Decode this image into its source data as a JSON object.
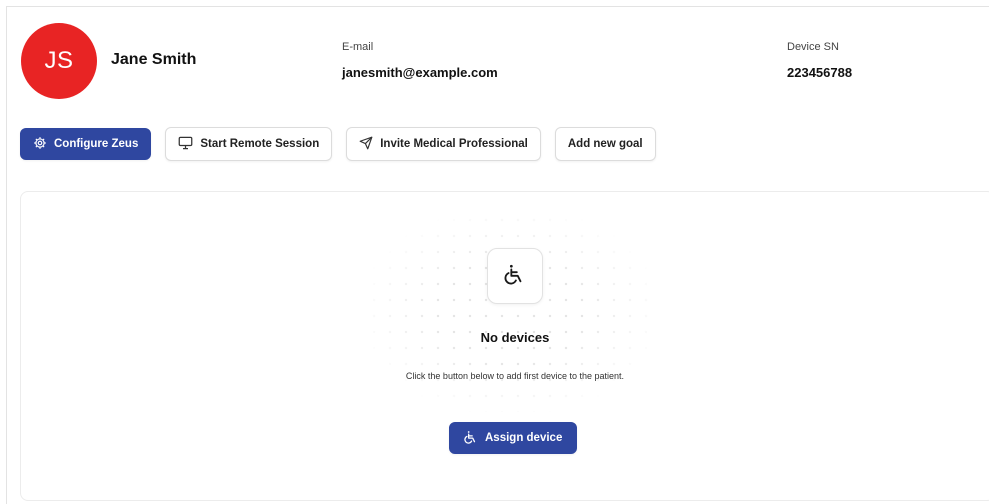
{
  "patient": {
    "initials": "JS",
    "name": "Jane Smith",
    "avatar_color": "#e82424"
  },
  "fields": {
    "email_label": "E-mail",
    "email_value": "janesmith@example.com",
    "sn_label": "Device SN",
    "sn_value": "223456788"
  },
  "toolbar": {
    "configure_label": "Configure Zeus",
    "remote_label": "Start Remote Session",
    "invite_label": "Invite Medical Professional",
    "goal_label": "Add new goal"
  },
  "empty_state": {
    "title": "No devices",
    "description": "Click the button below to add first device to the patient.",
    "assign_label": "Assign device",
    "icon": "wheelchair-icon"
  },
  "colors": {
    "primary": "#2f47a0",
    "avatar": "#e82424"
  }
}
